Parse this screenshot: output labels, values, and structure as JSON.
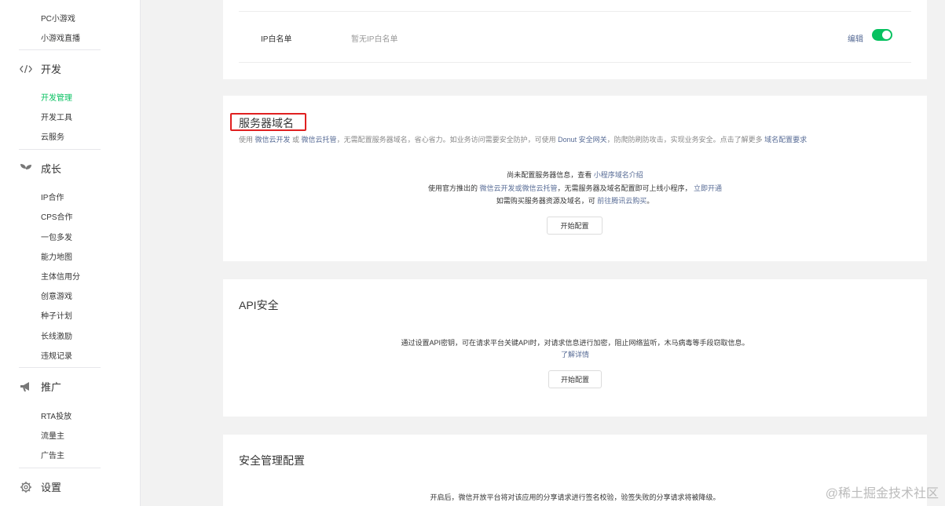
{
  "sidebar": {
    "top_items": [
      "PC小游戏",
      "小游戏直播"
    ],
    "dev_group": {
      "label": "开发",
      "items": [
        "开发管理",
        "开发工具",
        "云服务"
      ]
    },
    "growth_group": {
      "label": "成长",
      "items": [
        "IP合作",
        "CPS合作",
        "一包多发",
        "能力地图",
        "主体信用分",
        "创意游戏",
        "种子计划",
        "长线激励",
        "违规记录"
      ]
    },
    "promo_group": {
      "label": "推广",
      "items": [
        "RTA投放",
        "流量主",
        "广告主"
      ]
    },
    "settings_group": {
      "label": "设置"
    },
    "active_item": "开发管理"
  },
  "ip_whitelist": {
    "label": "IP白名单",
    "value": "暂无IP白名单",
    "edit": "编辑",
    "toggle_on": true
  },
  "server_domain": {
    "title": "服务器域名",
    "desc_parts": [
      "使用 ",
      "微信云开发",
      " 或 ",
      "微信云托管",
      "，无需配置服务器域名，省心省力。如业务访问需要安全防护，可使用 ",
      "Donut 安全网关",
      "，防爬防刷防攻击，实现业务安全。点击了解更多 ",
      "域名配置要求"
    ],
    "line1": [
      "尚未配置服务器信息，查看 ",
      "小程序域名介绍"
    ],
    "line2": [
      "使用官方推出的 ",
      "微信云开发或微信云托管",
      "，无需服务器及域名配置即可上线小程序， ",
      "立即开通"
    ],
    "line3": [
      "如需购买服务器资源及域名，可 ",
      "前往腾讯云购买",
      "。"
    ],
    "button": "开始配置"
  },
  "api_security": {
    "title": "API安全",
    "line1": "通过设置API密钥，可在请求平台关键API时，对请求信息进行加密，阻止网络监听，木马病毒等手段窃取信息。",
    "link": "了解详情",
    "button": "开始配置"
  },
  "security_config": {
    "title": "安全管理配置",
    "line1": "开启后，微信开放平台将对该应用的分享请求进行签名校验，验签失败的分享请求将被降级。"
  },
  "watermark": "@稀土掘金技术社区",
  "colors": {
    "accent": "#07c160",
    "link": "#576b95",
    "highlight_box": "#e02020"
  }
}
